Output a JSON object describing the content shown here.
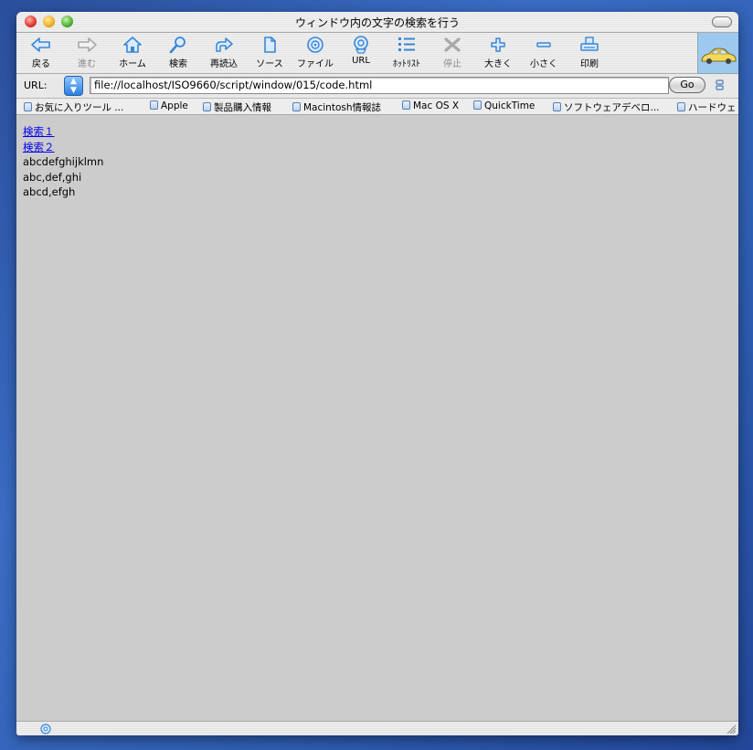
{
  "window": {
    "title": "ウィンドウ内の文字の検索を行う"
  },
  "toolbar": {
    "buttons": [
      {
        "label": "戻る",
        "icon": "back-arrow-icon",
        "enabled": true
      },
      {
        "label": "進む",
        "icon": "forward-arrow-icon",
        "enabled": false
      },
      {
        "label": "ホーム",
        "icon": "home-icon",
        "enabled": true
      },
      {
        "label": "検索",
        "icon": "search-icon",
        "enabled": true
      },
      {
        "label": "再読込",
        "icon": "reload-icon",
        "enabled": true
      },
      {
        "label": "ソース",
        "icon": "document-icon",
        "enabled": true
      },
      {
        "label": "ファイル",
        "icon": "file-disc-icon",
        "enabled": true
      },
      {
        "label": "URL",
        "icon": "url-globe-icon",
        "enabled": true
      },
      {
        "label": "ﾎｯﾄﾘｽﾄ",
        "icon": "hotlist-icon",
        "enabled": true
      },
      {
        "label": "停止",
        "icon": "stop-icon",
        "enabled": false
      },
      {
        "label": "大きく",
        "icon": "plus-icon",
        "enabled": true
      },
      {
        "label": "小さく",
        "icon": "minus-icon",
        "enabled": true
      },
      {
        "label": "印刷",
        "icon": "print-icon",
        "enabled": true
      }
    ]
  },
  "address": {
    "label": "URL:",
    "value": "file://localhost/ISO9660/script/window/015/code.html",
    "go_label": "Go"
  },
  "favorites": [
    "お気に入りツール ...",
    "Apple",
    "製品購入情報",
    "Macintosh情報誌",
    "Mac OS X",
    "QuickTime",
    "ソフトウェアデベロ...",
    "ハードウェ"
  ],
  "content": {
    "links": [
      "検索１",
      "検索２"
    ],
    "lines": [
      "abcdefghijklmn",
      "abc,def,ghi",
      "abcd,efgh"
    ]
  },
  "colors": {
    "link": "#0000ee",
    "page_background": "#cccccc",
    "icon_blue": "#3a86d4",
    "icon_disabled": "#a8a8a8"
  }
}
